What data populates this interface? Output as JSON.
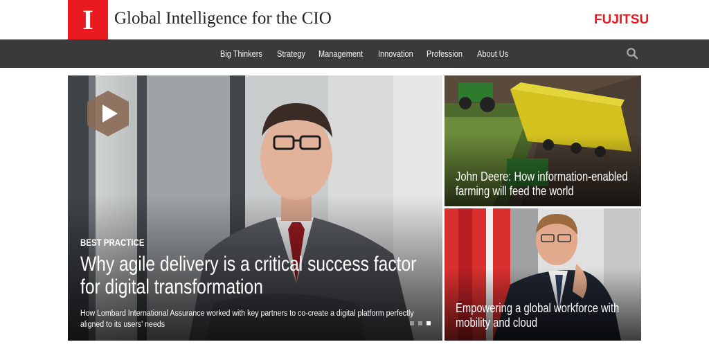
{
  "header": {
    "logo_letter": "I",
    "site_title": "Global Intelligence for the CIO",
    "sponsor_logo": "FUJITSU"
  },
  "nav": {
    "items": [
      {
        "label": "Big Thinkers"
      },
      {
        "label": "Strategy"
      },
      {
        "label": "Management"
      },
      {
        "label": "Innovation"
      },
      {
        "label": "Profession"
      },
      {
        "label": "About Us"
      }
    ],
    "search_icon": "search-icon"
  },
  "hero": {
    "kicker": "BEST PRACTICE",
    "headline": "Why agile delivery is a critical success factor for digital transformation",
    "subtitle": "How Lombard International Assurance worked with key partners to co-create a digital platform perfectly aligned to its users' needs",
    "play_icon": "play-icon",
    "slides_total": 3,
    "slide_active": 3
  },
  "side_cards": [
    {
      "headline": "John Deere: How information-enabled farming will feed the world"
    },
    {
      "headline": "Empowering a global workforce with mobility and cloud"
    }
  ],
  "colors": {
    "brand_red": "#e8191f",
    "nav_bg": "#3a3a3a",
    "play_hex": "#8a6a55"
  }
}
